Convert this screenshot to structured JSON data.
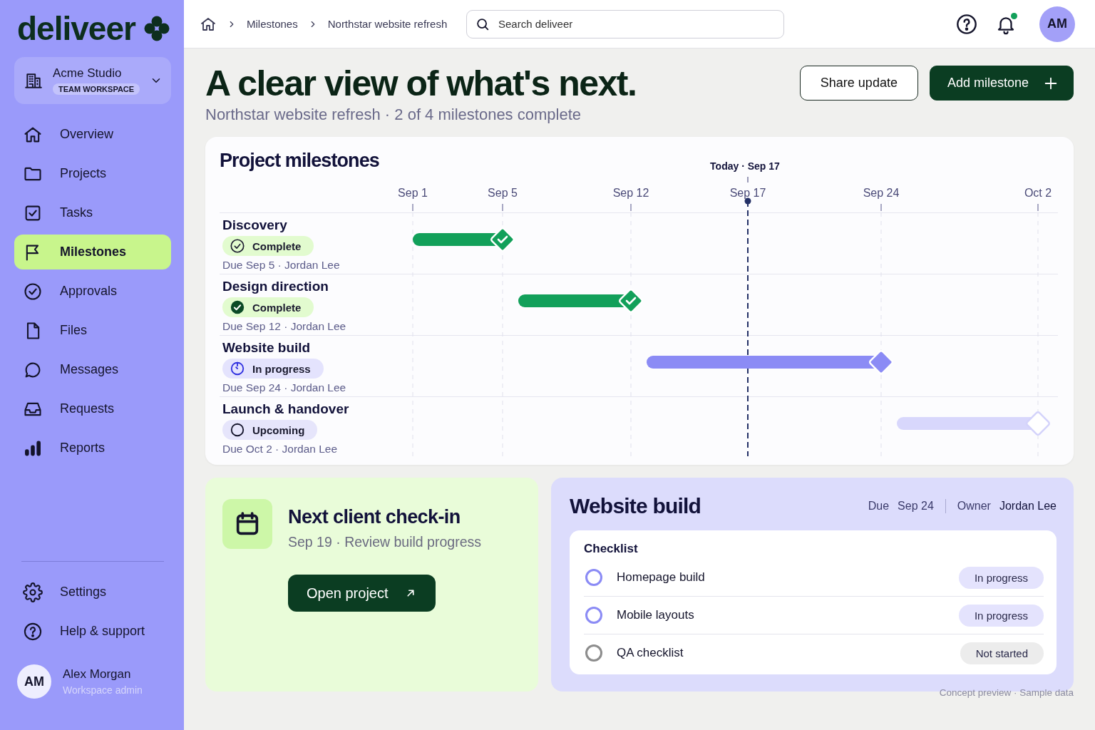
{
  "brand": {
    "name": "deliveer"
  },
  "workspace": {
    "name": "Acme Studio",
    "badge": "TEAM WORKSPACE"
  },
  "nav": [
    {
      "label": "Overview",
      "selected": false
    },
    {
      "label": "Projects",
      "selected": false
    },
    {
      "label": "Tasks",
      "selected": false
    },
    {
      "label": "Milestones",
      "selected": true
    },
    {
      "label": "Approvals",
      "selected": false
    },
    {
      "label": "Files",
      "selected": false
    },
    {
      "label": "Messages",
      "selected": false
    },
    {
      "label": "Requests",
      "selected": false
    },
    {
      "label": "Reports",
      "selected": false
    }
  ],
  "footer_nav": [
    {
      "label": "Settings",
      "selected": false
    },
    {
      "label": "Help & support",
      "selected": false
    }
  ],
  "user": {
    "initials": "AM",
    "name": "Alex Morgan",
    "role": "Workspace admin"
  },
  "breadcrumbs": [
    "Milestones",
    "Northstar website refresh"
  ],
  "search": {
    "placeholder": "Search deliveer"
  },
  "notifications": {
    "unread": true
  },
  "avatar": {
    "initials": "AM"
  },
  "header": {
    "title": "A clear view of what's next.",
    "subtitle": "Northstar website refresh · 2 of 4 milestones complete",
    "buttons": [
      {
        "label": "Share update",
        "kind": "secondary"
      },
      {
        "label": "Add milestone",
        "kind": "primary"
      }
    ]
  },
  "milestones_panel": {
    "title": "Project milestones",
    "today_label": "Today · Sep 17",
    "ticks": [
      {
        "label": "Sep 1",
        "today": false
      },
      {
        "label": "Sep 5",
        "today": false
      },
      {
        "label": "Sep 12",
        "today": false
      },
      {
        "label": "Sep 17",
        "today": true
      },
      {
        "label": "Sep 24",
        "today": false
      },
      {
        "label": "Oct 2",
        "today": false
      }
    ],
    "rows": [
      {
        "name": "Discovery",
        "kind": "complete",
        "status_label": "Complete",
        "filled": false,
        "meta": "Due Sep 5 · Jordan Lee"
      },
      {
        "name": "Design direction",
        "kind": "complete",
        "status_label": "Complete",
        "filled": true,
        "meta": "Due Sep 12 · Jordan Lee"
      },
      {
        "name": "Website build",
        "kind": "in_progress",
        "status_label": "In progress",
        "meta": "Due Sep 24 · Jordan Lee"
      },
      {
        "name": "Launch & handover",
        "kind": "upcoming",
        "status_label": "Upcoming",
        "meta": "Due Oct 2 · Jordan Lee"
      }
    ]
  },
  "checkin": {
    "title": "Next client check-in",
    "detail": "Sep 19 · Review build progress",
    "button": "Open project"
  },
  "build": {
    "title": "Website build",
    "due_label": "Due",
    "due": "Sep 24",
    "owner_label": "Owner",
    "owner": "Jordan Lee",
    "checklist_title": "Checklist",
    "items": [
      {
        "label": "Homepage build",
        "kind": "in_progress",
        "status_label": "In progress"
      },
      {
        "label": "Mobile layouts",
        "kind": "in_progress",
        "status_label": "In progress"
      },
      {
        "label": "QA checklist",
        "kind": "not_started",
        "status_label": "Not started"
      }
    ]
  },
  "footnote": "Concept preview · Sample data"
}
